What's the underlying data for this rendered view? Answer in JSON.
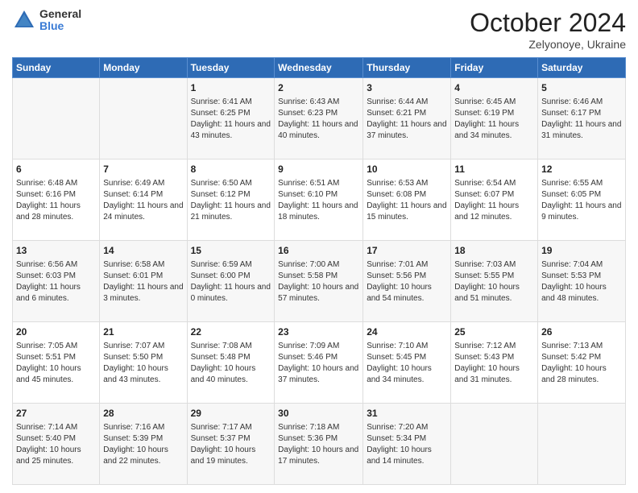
{
  "header": {
    "logo_general": "General",
    "logo_blue": "Blue",
    "month_title": "October 2024",
    "location": "Zelyonoye, Ukraine"
  },
  "days_of_week": [
    "Sunday",
    "Monday",
    "Tuesday",
    "Wednesday",
    "Thursday",
    "Friday",
    "Saturday"
  ],
  "weeks": [
    [
      {
        "day": "",
        "text": ""
      },
      {
        "day": "",
        "text": ""
      },
      {
        "day": "1",
        "text": "Sunrise: 6:41 AM\nSunset: 6:25 PM\nDaylight: 11 hours and 43 minutes."
      },
      {
        "day": "2",
        "text": "Sunrise: 6:43 AM\nSunset: 6:23 PM\nDaylight: 11 hours and 40 minutes."
      },
      {
        "day": "3",
        "text": "Sunrise: 6:44 AM\nSunset: 6:21 PM\nDaylight: 11 hours and 37 minutes."
      },
      {
        "day": "4",
        "text": "Sunrise: 6:45 AM\nSunset: 6:19 PM\nDaylight: 11 hours and 34 minutes."
      },
      {
        "day": "5",
        "text": "Sunrise: 6:46 AM\nSunset: 6:17 PM\nDaylight: 11 hours and 31 minutes."
      }
    ],
    [
      {
        "day": "6",
        "text": "Sunrise: 6:48 AM\nSunset: 6:16 PM\nDaylight: 11 hours and 28 minutes."
      },
      {
        "day": "7",
        "text": "Sunrise: 6:49 AM\nSunset: 6:14 PM\nDaylight: 11 hours and 24 minutes."
      },
      {
        "day": "8",
        "text": "Sunrise: 6:50 AM\nSunset: 6:12 PM\nDaylight: 11 hours and 21 minutes."
      },
      {
        "day": "9",
        "text": "Sunrise: 6:51 AM\nSunset: 6:10 PM\nDaylight: 11 hours and 18 minutes."
      },
      {
        "day": "10",
        "text": "Sunrise: 6:53 AM\nSunset: 6:08 PM\nDaylight: 11 hours and 15 minutes."
      },
      {
        "day": "11",
        "text": "Sunrise: 6:54 AM\nSunset: 6:07 PM\nDaylight: 11 hours and 12 minutes."
      },
      {
        "day": "12",
        "text": "Sunrise: 6:55 AM\nSunset: 6:05 PM\nDaylight: 11 hours and 9 minutes."
      }
    ],
    [
      {
        "day": "13",
        "text": "Sunrise: 6:56 AM\nSunset: 6:03 PM\nDaylight: 11 hours and 6 minutes."
      },
      {
        "day": "14",
        "text": "Sunrise: 6:58 AM\nSunset: 6:01 PM\nDaylight: 11 hours and 3 minutes."
      },
      {
        "day": "15",
        "text": "Sunrise: 6:59 AM\nSunset: 6:00 PM\nDaylight: 11 hours and 0 minutes."
      },
      {
        "day": "16",
        "text": "Sunrise: 7:00 AM\nSunset: 5:58 PM\nDaylight: 10 hours and 57 minutes."
      },
      {
        "day": "17",
        "text": "Sunrise: 7:01 AM\nSunset: 5:56 PM\nDaylight: 10 hours and 54 minutes."
      },
      {
        "day": "18",
        "text": "Sunrise: 7:03 AM\nSunset: 5:55 PM\nDaylight: 10 hours and 51 minutes."
      },
      {
        "day": "19",
        "text": "Sunrise: 7:04 AM\nSunset: 5:53 PM\nDaylight: 10 hours and 48 minutes."
      }
    ],
    [
      {
        "day": "20",
        "text": "Sunrise: 7:05 AM\nSunset: 5:51 PM\nDaylight: 10 hours and 45 minutes."
      },
      {
        "day": "21",
        "text": "Sunrise: 7:07 AM\nSunset: 5:50 PM\nDaylight: 10 hours and 43 minutes."
      },
      {
        "day": "22",
        "text": "Sunrise: 7:08 AM\nSunset: 5:48 PM\nDaylight: 10 hours and 40 minutes."
      },
      {
        "day": "23",
        "text": "Sunrise: 7:09 AM\nSunset: 5:46 PM\nDaylight: 10 hours and 37 minutes."
      },
      {
        "day": "24",
        "text": "Sunrise: 7:10 AM\nSunset: 5:45 PM\nDaylight: 10 hours and 34 minutes."
      },
      {
        "day": "25",
        "text": "Sunrise: 7:12 AM\nSunset: 5:43 PM\nDaylight: 10 hours and 31 minutes."
      },
      {
        "day": "26",
        "text": "Sunrise: 7:13 AM\nSunset: 5:42 PM\nDaylight: 10 hours and 28 minutes."
      }
    ],
    [
      {
        "day": "27",
        "text": "Sunrise: 7:14 AM\nSunset: 5:40 PM\nDaylight: 10 hours and 25 minutes."
      },
      {
        "day": "28",
        "text": "Sunrise: 7:16 AM\nSunset: 5:39 PM\nDaylight: 10 hours and 22 minutes."
      },
      {
        "day": "29",
        "text": "Sunrise: 7:17 AM\nSunset: 5:37 PM\nDaylight: 10 hours and 19 minutes."
      },
      {
        "day": "30",
        "text": "Sunrise: 7:18 AM\nSunset: 5:36 PM\nDaylight: 10 hours and 17 minutes."
      },
      {
        "day": "31",
        "text": "Sunrise: 7:20 AM\nSunset: 5:34 PM\nDaylight: 10 hours and 14 minutes."
      },
      {
        "day": "",
        "text": ""
      },
      {
        "day": "",
        "text": ""
      }
    ]
  ]
}
